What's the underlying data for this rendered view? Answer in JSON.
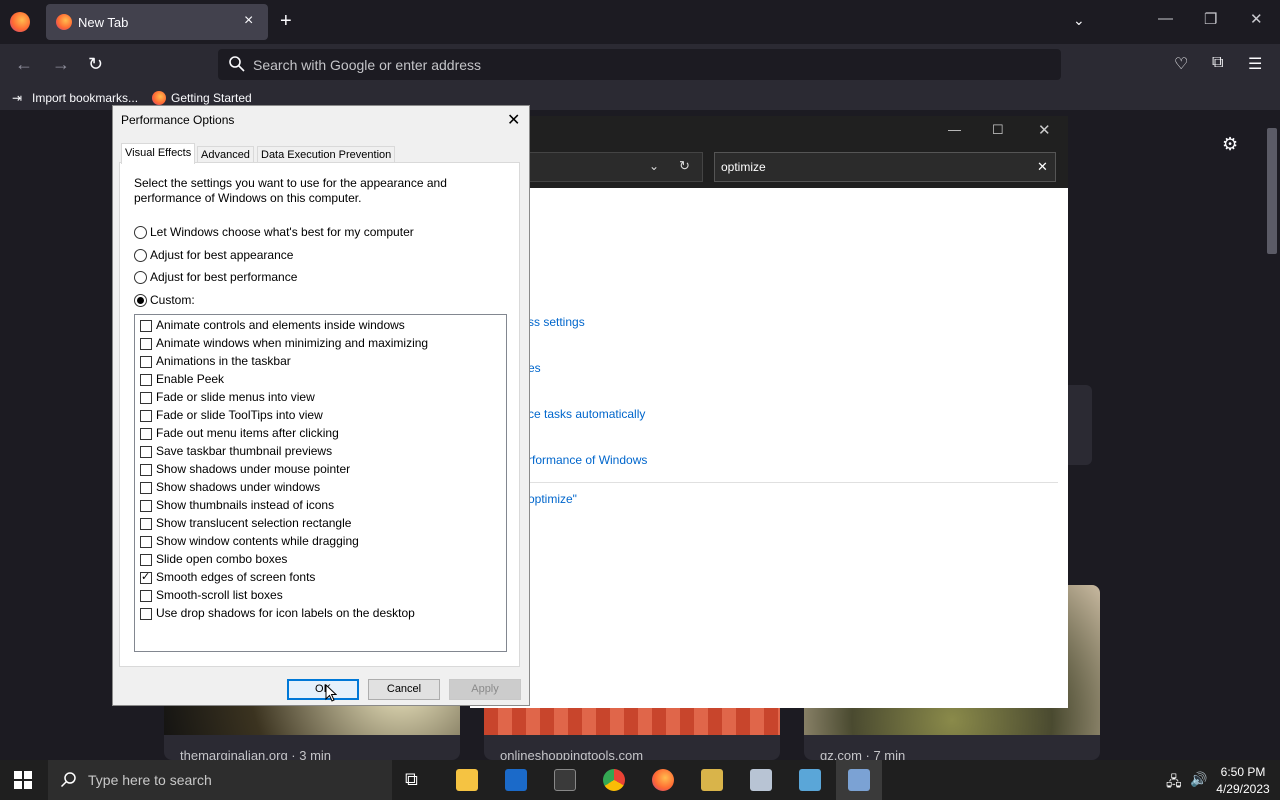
{
  "browser": {
    "tab_title": "New Tab",
    "new_tab_symbol": "+",
    "close_symbol": "×",
    "url_placeholder": "Search with Google or enter address",
    "bookmarks": [
      "Import bookmarks...",
      "Getting Started"
    ]
  },
  "newtab_cards": [
    {
      "label": "themarginalian.org · 3 min"
    },
    {
      "label": "onlineshoppingtools.com"
    },
    {
      "label": "gz.com · 7 min"
    }
  ],
  "control_panel": {
    "search_value": "optimize",
    "results": [
      "ss settings",
      "es",
      "ce tasks automatically",
      "rformance of Windows",
      "optimize\""
    ]
  },
  "dialog": {
    "title": "Performance Options",
    "tabs": [
      "Visual Effects",
      "Advanced",
      "Data Execution Prevention"
    ],
    "active_tab": "Visual Effects",
    "description": "Select the settings you want to use for the appearance and performance of Windows on this computer.",
    "radios": [
      {
        "label": "Let Windows choose what's best for my computer",
        "selected": false
      },
      {
        "label": "Adjust for best appearance",
        "selected": false
      },
      {
        "label": "Adjust for best performance",
        "selected": false
      },
      {
        "label": "Custom:",
        "selected": true
      }
    ],
    "options": [
      {
        "label": "Animate controls and elements inside windows",
        "checked": false
      },
      {
        "label": "Animate windows when minimizing and maximizing",
        "checked": false
      },
      {
        "label": "Animations in the taskbar",
        "checked": false
      },
      {
        "label": "Enable Peek",
        "checked": false
      },
      {
        "label": "Fade or slide menus into view",
        "checked": false
      },
      {
        "label": "Fade or slide ToolTips into view",
        "checked": false
      },
      {
        "label": "Fade out menu items after clicking",
        "checked": false
      },
      {
        "label": "Save taskbar thumbnail previews",
        "checked": false
      },
      {
        "label": "Show shadows under mouse pointer",
        "checked": false
      },
      {
        "label": "Show shadows under windows",
        "checked": false
      },
      {
        "label": "Show thumbnails instead of icons",
        "checked": false
      },
      {
        "label": "Show translucent selection rectangle",
        "checked": false
      },
      {
        "label": "Show window contents while dragging",
        "checked": false
      },
      {
        "label": "Slide open combo boxes",
        "checked": false
      },
      {
        "label": "Smooth edges of screen fonts",
        "checked": true
      },
      {
        "label": "Smooth-scroll list boxes",
        "checked": false
      },
      {
        "label": "Use drop shadows for icon labels on the desktop",
        "checked": false
      }
    ],
    "buttons": {
      "ok": "OK",
      "cancel": "Cancel",
      "apply": "Apply"
    }
  },
  "taskbar": {
    "search_placeholder": "Type here to search",
    "time": "6:50 PM",
    "date": "4/29/2023",
    "apps": [
      "task-view",
      "file-explorer",
      "store",
      "terminal",
      "chrome",
      "firefox",
      "app-a",
      "app-b",
      "control-panel",
      "performance"
    ]
  },
  "colors": {
    "accent": "#0078d7",
    "link": "#0066cc",
    "firefox_dark": "#1c1b22"
  }
}
